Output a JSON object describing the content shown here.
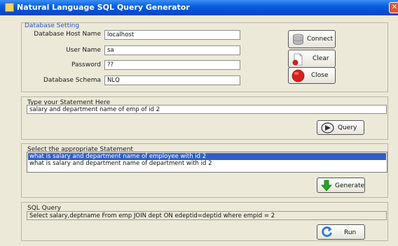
{
  "window": {
    "title": "Natural Language SQL Query Generator"
  },
  "db_setting": {
    "title": "Database Setting",
    "host": {
      "label": "Database Host Name",
      "value": "localhost"
    },
    "user": {
      "label": "User Name",
      "value": "sa"
    },
    "password": {
      "label": "Password",
      "value": "??"
    },
    "schema": {
      "label": "Database Schema",
      "value": "NLQ"
    }
  },
  "buttons": {
    "connect": "Connect",
    "clear": "Clear",
    "close": "Close",
    "query": "Query",
    "generate": "Generate",
    "run": "Run"
  },
  "statement_panel": {
    "title": "Type your Statement Here",
    "value": "salary and department name of emp of id 2"
  },
  "select_panel": {
    "title": "Select the appropriate Statement",
    "items": [
      "what is salary and department name of employee with id 2",
      "what is salary and department name of department with id 2"
    ],
    "selected_index": 0
  },
  "sql_panel": {
    "title": "SQL Query",
    "value": "Select salary,deptname From emp JOIN dept ON edeptid=deptid  where empid = 2"
  },
  "colors": {
    "titlebar": "#0a5fe0",
    "panel_title": "#2c55b8",
    "selection": "#2f5fc7",
    "close_button": "#d8201a",
    "generate_arrow": "#1faa22",
    "run_icon": "#2a7ad8"
  },
  "icons": [
    "app-icon",
    "window-close-icon",
    "database-icon",
    "clear-icon",
    "close-icon",
    "query-icon",
    "generate-icon",
    "run-icon"
  ]
}
